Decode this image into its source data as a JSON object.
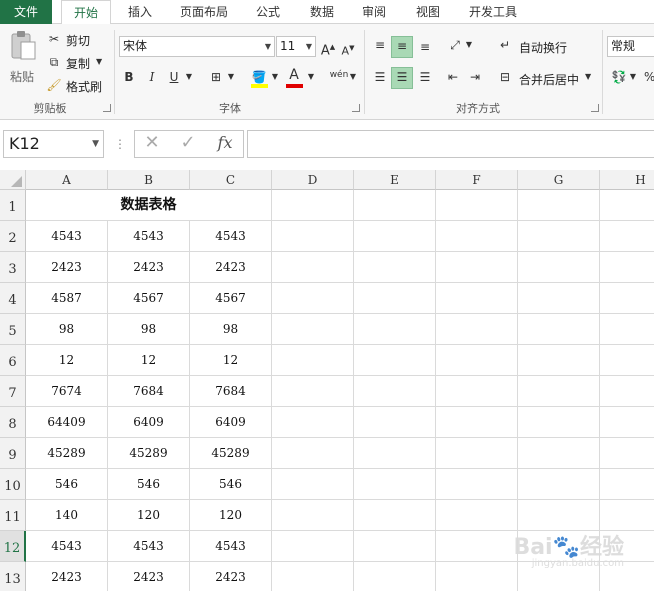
{
  "tabs": [
    "文件",
    "开始",
    "插入",
    "页面布局",
    "公式",
    "数据",
    "审阅",
    "视图",
    "开发工具"
  ],
  "ribbon": {
    "clipboard": {
      "paste": "粘贴",
      "cut": "剪切",
      "copy": "复制",
      "format_painter": "格式刷",
      "label": "剪贴板"
    },
    "font": {
      "name": "宋体",
      "size": "11",
      "bold": "B",
      "italic": "I",
      "underline": "U",
      "grow": "A",
      "shrink": "A",
      "phonetic": "wén",
      "label": "字体"
    },
    "alignment": {
      "wrap": "自动换行",
      "merge": "合并后居中",
      "label": "对齐方式"
    },
    "number": {
      "format": "常规"
    }
  },
  "formula_bar": {
    "name_box": "K12",
    "fx": "fx",
    "value": ""
  },
  "columns": [
    "A",
    "B",
    "C",
    "D",
    "E",
    "F",
    "G",
    "H"
  ],
  "rows": [
    "1",
    "2",
    "3",
    "4",
    "5",
    "6",
    "7",
    "8",
    "9",
    "10",
    "11",
    "12",
    "13"
  ],
  "active_row": "12",
  "title": "数据表格",
  "data": [
    [
      "4543",
      "4543",
      "4543"
    ],
    [
      "2423",
      "2423",
      "2423"
    ],
    [
      "4587",
      "4567",
      "4567"
    ],
    [
      "98",
      "98",
      "98"
    ],
    [
      "12",
      "12",
      "12"
    ],
    [
      "7674",
      "7684",
      "7684"
    ],
    [
      "64409",
      "6409",
      "6409"
    ],
    [
      "45289",
      "45289",
      "45289"
    ],
    [
      "546",
      "546",
      "546"
    ],
    [
      "140",
      "120",
      "120"
    ],
    [
      "4543",
      "4543",
      "4543"
    ],
    [
      "2423",
      "2423",
      "2423"
    ]
  ],
  "colors": {
    "accent": "#217346",
    "selected": "#a9d9b5"
  }
}
